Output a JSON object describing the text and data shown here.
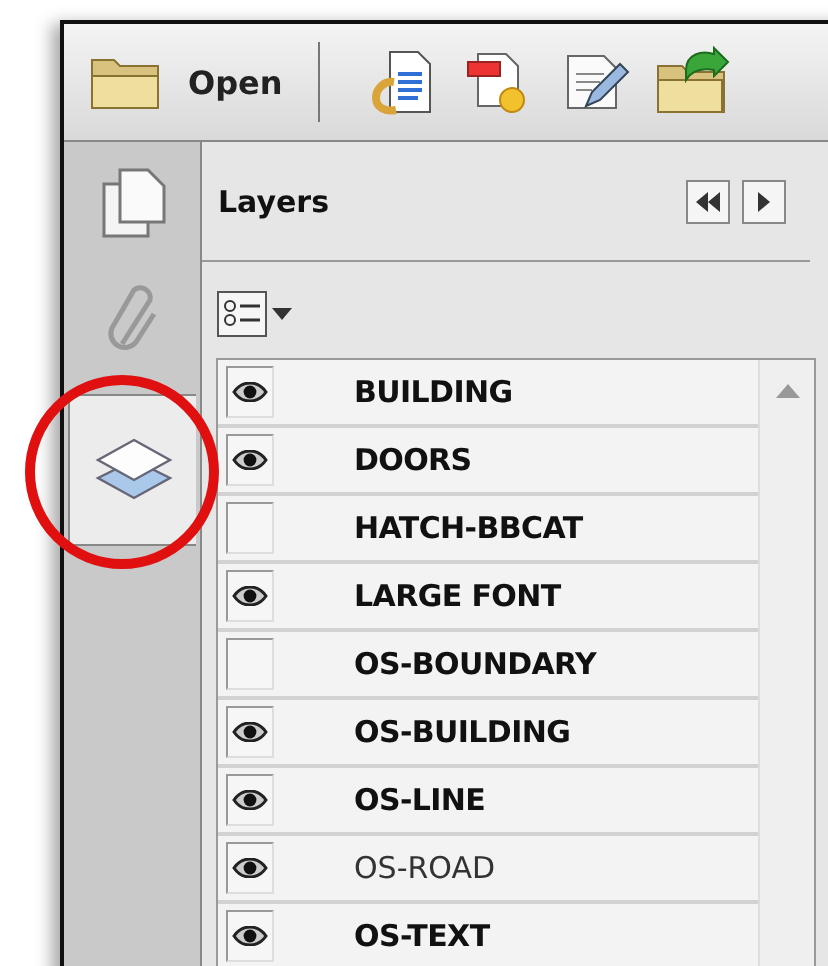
{
  "toolbar": {
    "open_label": "Open"
  },
  "sidebar": {
    "tabs": [
      {
        "kind": "pages",
        "selected": false
      },
      {
        "kind": "attachments",
        "selected": false
      },
      {
        "kind": "layers",
        "selected": true
      }
    ]
  },
  "panel": {
    "title": "Layers"
  },
  "layers": [
    {
      "name": "BUILDING",
      "visible": true,
      "bold": true
    },
    {
      "name": "DOORS",
      "visible": true,
      "bold": true
    },
    {
      "name": "HATCH-BBCAT",
      "visible": false,
      "bold": true
    },
    {
      "name": "LARGE FONT",
      "visible": true,
      "bold": true
    },
    {
      "name": "OS-BOUNDARY",
      "visible": false,
      "bold": true
    },
    {
      "name": "OS-BUILDING",
      "visible": true,
      "bold": true
    },
    {
      "name": "OS-LINE",
      "visible": true,
      "bold": true
    },
    {
      "name": "OS-ROAD",
      "visible": true,
      "bold": false
    },
    {
      "name": "OS-TEXT",
      "visible": true,
      "bold": true
    }
  ]
}
